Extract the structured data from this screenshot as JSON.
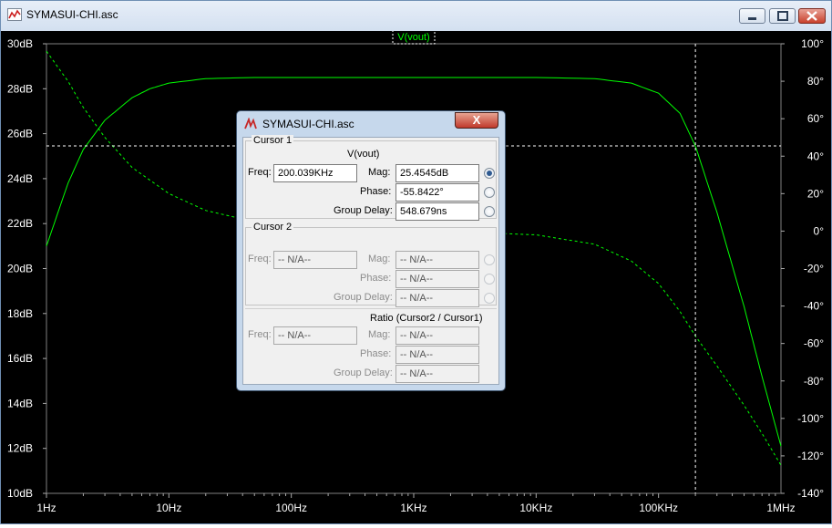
{
  "window": {
    "title": "SYMASUI-CHI.asc",
    "icon": "ltspice-waveform-icon",
    "buttons": [
      "minimize-icon",
      "maximize-icon",
      "close-icon"
    ]
  },
  "trace_label": "V(vout)",
  "colors": {
    "background": "#000000",
    "trace": "#00ff00",
    "grid": "#ffffff",
    "axis_text": "#ffffff"
  },
  "chart_data": {
    "type": "line",
    "title": "V(vout)",
    "xscale": "log",
    "xlim": [
      1,
      1000000
    ],
    "x_tick_labels": [
      "1Hz",
      "10Hz",
      "100Hz",
      "1KHz",
      "10KHz",
      "100KHz",
      "1MHz"
    ],
    "y_left_label_ticks": [
      "30dB",
      "28dB",
      "26dB",
      "24dB",
      "22dB",
      "20dB",
      "18dB",
      "16dB",
      "14dB",
      "12dB",
      "10dB"
    ],
    "ylim_left": [
      10,
      30
    ],
    "y_right_label_ticks": [
      "100°",
      "80°",
      "60°",
      "40°",
      "20°",
      "0°",
      "-20°",
      "-40°",
      "-60°",
      "-80°",
      "-100°",
      "-120°",
      "-140°"
    ],
    "ylim_right": [
      -140,
      100
    ],
    "grid": false,
    "series": [
      {
        "name": "V(vout)",
        "axis": "left",
        "style": "solid",
        "x": [
          1,
          1.5,
          2,
          3,
          5,
          7,
          10,
          20,
          50,
          100,
          1000,
          10000,
          30000,
          60000,
          100000,
          150000,
          200000,
          300000,
          500000,
          700000,
          1000000
        ],
        "y": [
          21.0,
          23.8,
          25.3,
          26.6,
          27.6,
          28.0,
          28.25,
          28.45,
          28.5,
          28.5,
          28.5,
          28.5,
          28.45,
          28.25,
          27.8,
          26.9,
          25.45,
          22.5,
          18.3,
          15.2,
          12.1
        ]
      },
      {
        "name": "V(vout) phase",
        "axis": "right",
        "style": "dashed",
        "x": [
          1,
          1.5,
          2,
          3,
          5,
          10,
          20,
          50,
          100,
          1000,
          10000,
          30000,
          60000,
          100000,
          150000,
          200000,
          300000,
          500000,
          700000,
          1000000
        ],
        "y": [
          96,
          80,
          66,
          50,
          34,
          20,
          11,
          5,
          3,
          0.5,
          -2,
          -7,
          -16,
          -28,
          -43,
          -56,
          -72,
          -93,
          -108,
          -125
        ]
      }
    ],
    "cursor": {
      "x": 200039,
      "y": 25.4545
    }
  },
  "dialog": {
    "title": "SYMASUI-CHI.asc",
    "close_label": "X",
    "cursor1": {
      "group_label": "Cursor 1",
      "trace": "V(vout)",
      "freq_label": "Freq:",
      "freq": "200.039KHz",
      "mag_label": "Mag:",
      "mag": "25.4545dB",
      "phase_label": "Phase:",
      "phase": "-55.8422°",
      "delay_label": "Group Delay:",
      "delay": "548.679ns"
    },
    "cursor2": {
      "group_label": "Cursor 2",
      "freq_label": "Freq:",
      "freq": "-- N/A--",
      "mag_label": "Mag:",
      "mag": "-- N/A--",
      "phase_label": "Phase:",
      "phase": "-- N/A--",
      "delay_label": "Group Delay:",
      "delay": "-- N/A--"
    },
    "ratio": {
      "title": "Ratio (Cursor2 / Cursor1)",
      "freq_label": "Freq:",
      "freq": "-- N/A--",
      "mag_label": "Mag:",
      "mag": "-- N/A--",
      "phase_label": "Phase:",
      "phase": "-- N/A--",
      "delay_label": "Group Delay:",
      "delay": "-- N/A--"
    }
  }
}
